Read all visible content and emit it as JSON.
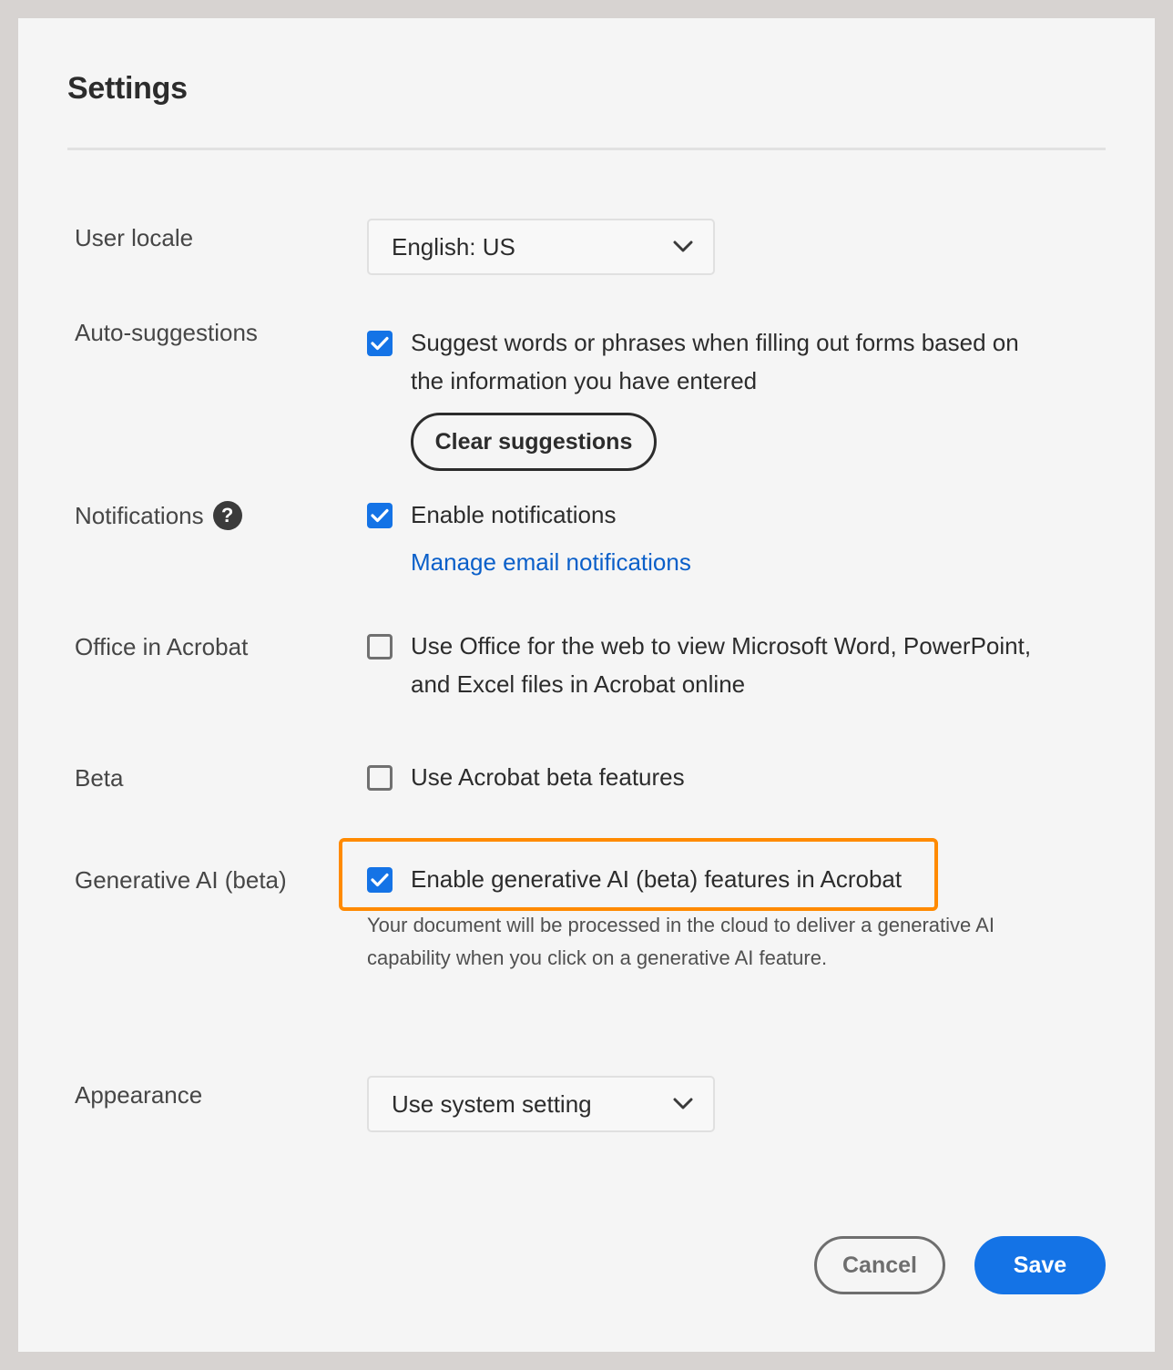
{
  "dialog": {
    "title": "Settings"
  },
  "user_locale": {
    "label": "User locale",
    "selected": "English: US"
  },
  "auto_suggestions": {
    "label": "Auto-suggestions",
    "checked": true,
    "text_line1": "Suggest words or phrases when filling out forms based on",
    "text_line2": "the information you have entered",
    "clear_button": "Clear suggestions"
  },
  "notifications": {
    "label": "Notifications",
    "help_icon": "?",
    "checked": true,
    "text": "Enable notifications",
    "manage_link": "Manage email notifications"
  },
  "office": {
    "label": "Office in Acrobat",
    "checked": false,
    "text_line1": "Use Office for the web to view Microsoft Word, PowerPoint,",
    "text_line2": "and Excel files in Acrobat online"
  },
  "beta": {
    "label": "Beta",
    "checked": false,
    "text": "Use Acrobat beta features"
  },
  "generative_ai": {
    "label": "Generative AI (beta)",
    "checked": true,
    "text": "Enable generative AI (beta) features in Acrobat",
    "desc_line1": "Your document will be processed in the cloud to deliver a generative AI",
    "desc_line2": "capability when you click on a generative AI feature.",
    "highlight_color": "#ff8a00"
  },
  "appearance": {
    "label": "Appearance",
    "selected": "Use system setting"
  },
  "footer": {
    "cancel": "Cancel",
    "save": "Save"
  },
  "colors": {
    "accent": "#1473e6",
    "link": "#0a5fc9"
  }
}
